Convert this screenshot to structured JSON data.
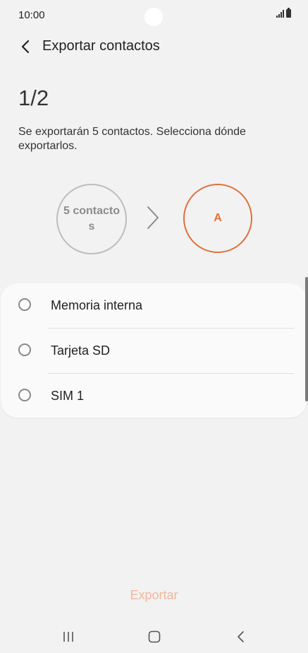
{
  "status_bar": {
    "time": "10:00"
  },
  "header": {
    "title": "Exportar contactos"
  },
  "step": "1/2",
  "description": "Se exportarán 5 contactos. Selecciona dónde exportarlos.",
  "transfer": {
    "source_label": "5 contacto s",
    "destination_label": "A"
  },
  "options": [
    {
      "label": "Memoria interna",
      "selected": false
    },
    {
      "label": "Tarjeta SD",
      "selected": false
    },
    {
      "label": "SIM 1",
      "selected": false
    }
  ],
  "footer": {
    "export_label": "Exportar"
  },
  "colors": {
    "accent": "#e0703a",
    "export_disabled": "#f0b79d",
    "background": "#f2f2f2"
  },
  "icons": [
    "back-arrow-icon",
    "chevron-right-icon",
    "signal-icon",
    "battery-icon",
    "recent-apps-icon",
    "home-icon",
    "nav-back-icon"
  ]
}
